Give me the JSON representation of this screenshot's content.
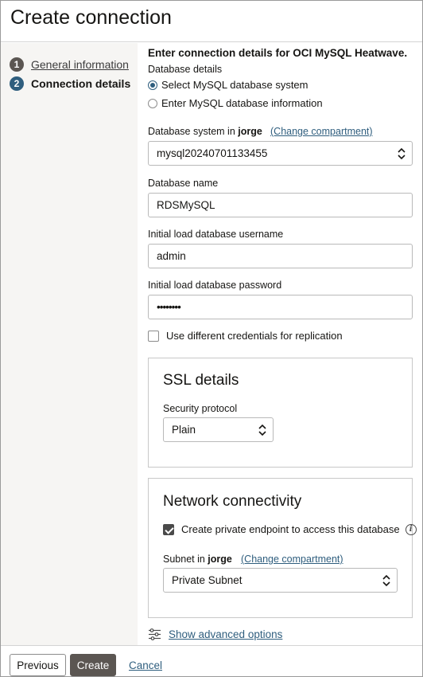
{
  "header": {
    "title": "Create connection"
  },
  "steps": [
    {
      "number": "1",
      "label": "General information"
    },
    {
      "number": "2",
      "label": "Connection details"
    }
  ],
  "form": {
    "section_title": "Enter connection details for OCI MySQL Heatwave.",
    "database_details_label": "Database details",
    "radio_options": [
      {
        "label": "Select MySQL database system",
        "selected": true
      },
      {
        "label": "Enter MySQL database information",
        "selected": false
      }
    ],
    "db_system_label_prefix": "Database system in ",
    "db_system_compartment": "jorge",
    "change_compartment": "(Change compartment)",
    "db_system_value": "mysql20240701133455",
    "db_name_label": "Database name",
    "db_name_value": "RDSMySQL",
    "username_label": "Initial load database username",
    "username_value": "admin",
    "password_label": "Initial load database password",
    "password_value": "••••••••",
    "different_credentials_label": "Use different credentials for replication"
  },
  "ssl": {
    "title": "SSL details",
    "protocol_label": "Security protocol",
    "protocol_value": "Plain"
  },
  "network": {
    "title": "Network connectivity",
    "private_endpoint_label": "Create private endpoint to access this database",
    "subnet_label_prefix": "Subnet in ",
    "subnet_compartment": "jorge",
    "change_compartment": "(Change compartment)",
    "subnet_value": "Private Subnet"
  },
  "advanced": {
    "label": "Show advanced options"
  },
  "footer": {
    "previous": "Previous",
    "create": "Create",
    "cancel": "Cancel"
  },
  "colors": {
    "accent": "#2f5e7e",
    "primary_button": "#5b5652",
    "left_pane": "#f6f5f3"
  }
}
